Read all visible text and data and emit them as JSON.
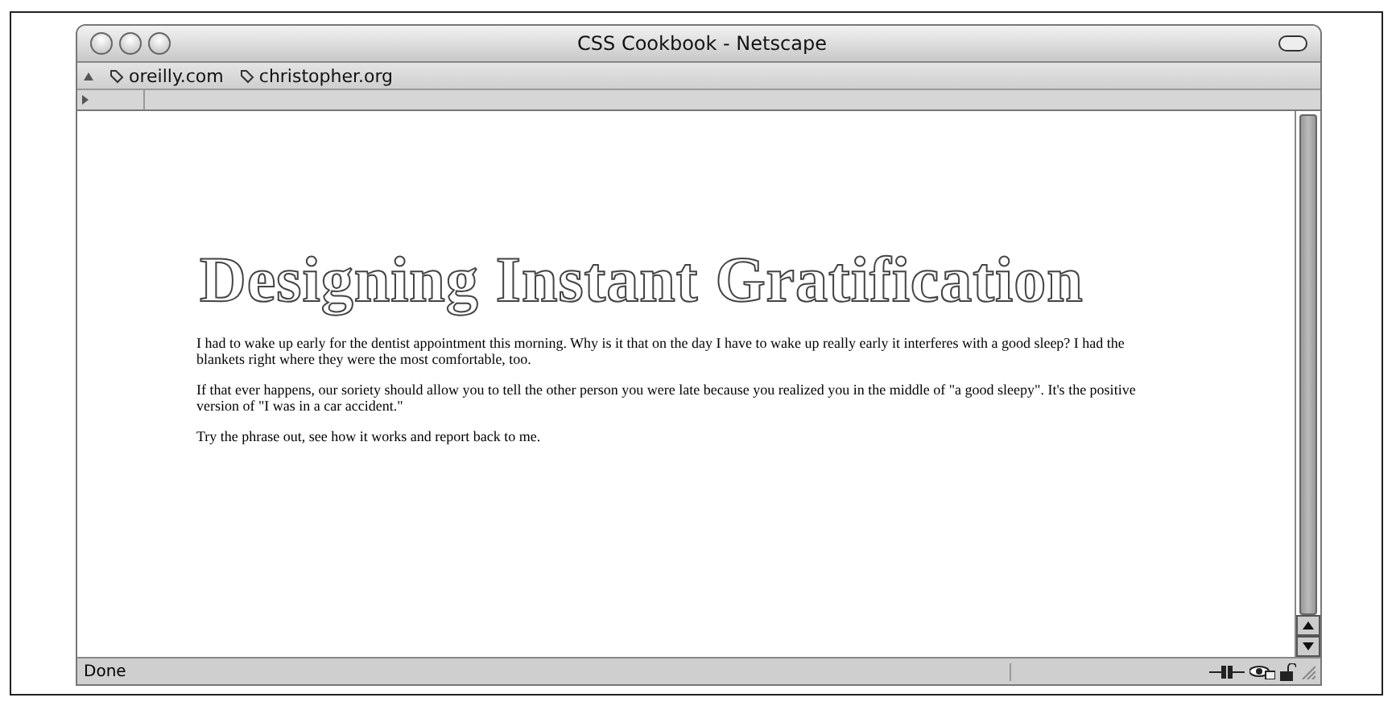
{
  "window": {
    "title": "CSS Cookbook - Netscape"
  },
  "bookmarks": [
    "oreilly.com",
    "christopher.org"
  ],
  "page": {
    "heading": "Designing Instant Gratification",
    "paragraphs": [
      "I had to wake up early for the dentist appointment this morning. Why is it that on the day I have to wake up really early it interferes with a good sleep? I had the blankets right where they were the most comfortable, too.",
      "If that ever happens, our soriety should allow you to tell the other person you were late because you realized you in the middle of \"a good sleepy\". It's the positive version of \"I was in a car accident.\"",
      "Try the phrase out, see how it works and report back to me."
    ]
  },
  "status_bar": {
    "text": "Done"
  }
}
